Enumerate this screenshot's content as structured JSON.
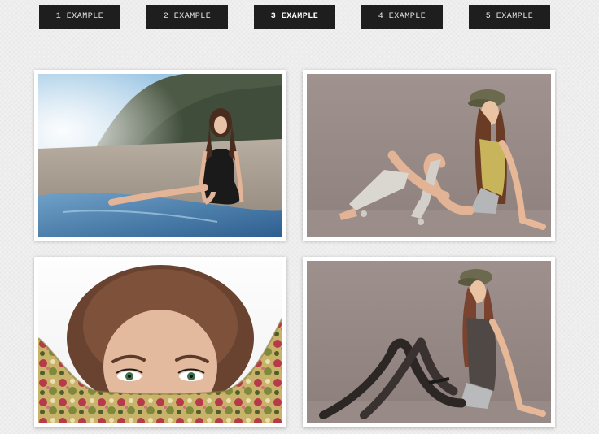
{
  "nav": {
    "items": [
      {
        "label": "1 EXAMPLE",
        "active": false
      },
      {
        "label": "2 EXAMPLE",
        "active": false
      },
      {
        "label": "3 EXAMPLE",
        "active": true
      },
      {
        "label": "4 EXAMPLE",
        "active": false
      },
      {
        "label": "5 EXAMPLE",
        "active": false
      }
    ]
  },
  "gallery": {
    "photos": [
      {
        "subject": "woman sitting on wet sand beach with misty hill behind"
      },
      {
        "subject": "woman in cap and leg warmers sitting on studio floor"
      },
      {
        "subject": "close-up of woman with floral scarf covering face"
      },
      {
        "subject": "woman in cap and dark stockings sitting on studio floor"
      }
    ]
  },
  "colors": {
    "nav_bg": "#1e1e1e",
    "nav_text": "#e6e6e6",
    "page_bg": "#f0f0f0",
    "frame": "#ffffff"
  }
}
